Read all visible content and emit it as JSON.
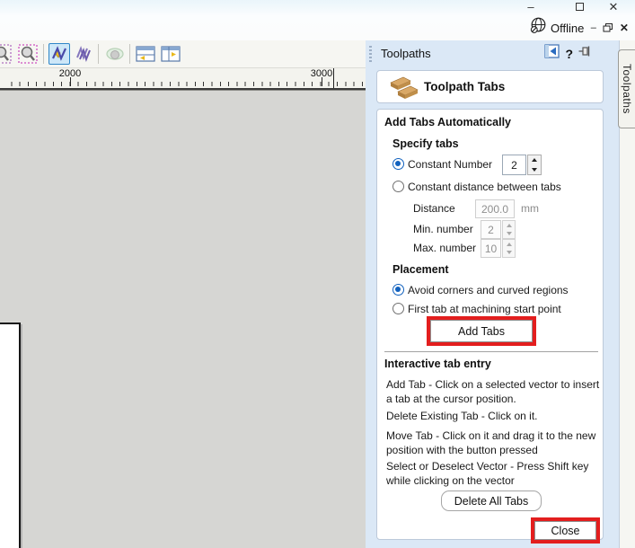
{
  "titlebar": {
    "offline_label": "Offline",
    "minimize_glyph": "–",
    "close_glyph": "✕",
    "mdi_minimize_glyph": "–",
    "mdi_close_glyph": "✕"
  },
  "ruler": {
    "labels": [
      "2000",
      "3000"
    ]
  },
  "panel": {
    "title": "Toolpaths",
    "help_glyph": "?",
    "side_tab_label": "Toolpaths",
    "header_card": {
      "title": "Toolpath Tabs"
    },
    "add_tabs": {
      "section_title": "Add Tabs Automatically",
      "specify_title": "Specify tabs",
      "constant_number_label": "Constant Number",
      "constant_number_value": "2",
      "constant_distance_label": "Constant distance between tabs",
      "distance_label": "Distance",
      "distance_value": "200.0",
      "distance_unit": "mm",
      "min_number_label": "Min. number",
      "min_number_value": "2",
      "max_number_label": "Max. number",
      "max_number_value": "10",
      "placement_title": "Placement",
      "avoid_corners_label": "Avoid corners and curved regions",
      "first_tab_label": "First tab at machining start point",
      "add_tabs_button": "Add Tabs"
    },
    "interactive": {
      "section_title": "Interactive tab entry",
      "instructions": [
        "Add Tab - Click on a selected vector to insert a tab at the cursor position.",
        "Delete Existing Tab - Click on it.",
        "Move Tab - Click on it and drag it to the new position with the button pressed",
        "Select or Deselect Vector - Press Shift key while clicking on the vector"
      ],
      "delete_all_button": "Delete All Tabs",
      "close_button": "Close"
    }
  },
  "colors": {
    "panel_bg": "#dbe8f6",
    "highlight_red": "#e31e1e",
    "radio_blue": "#1161be",
    "selected_tool_border": "#2f86c8",
    "tab_icon_tan": "#cf9a55"
  }
}
